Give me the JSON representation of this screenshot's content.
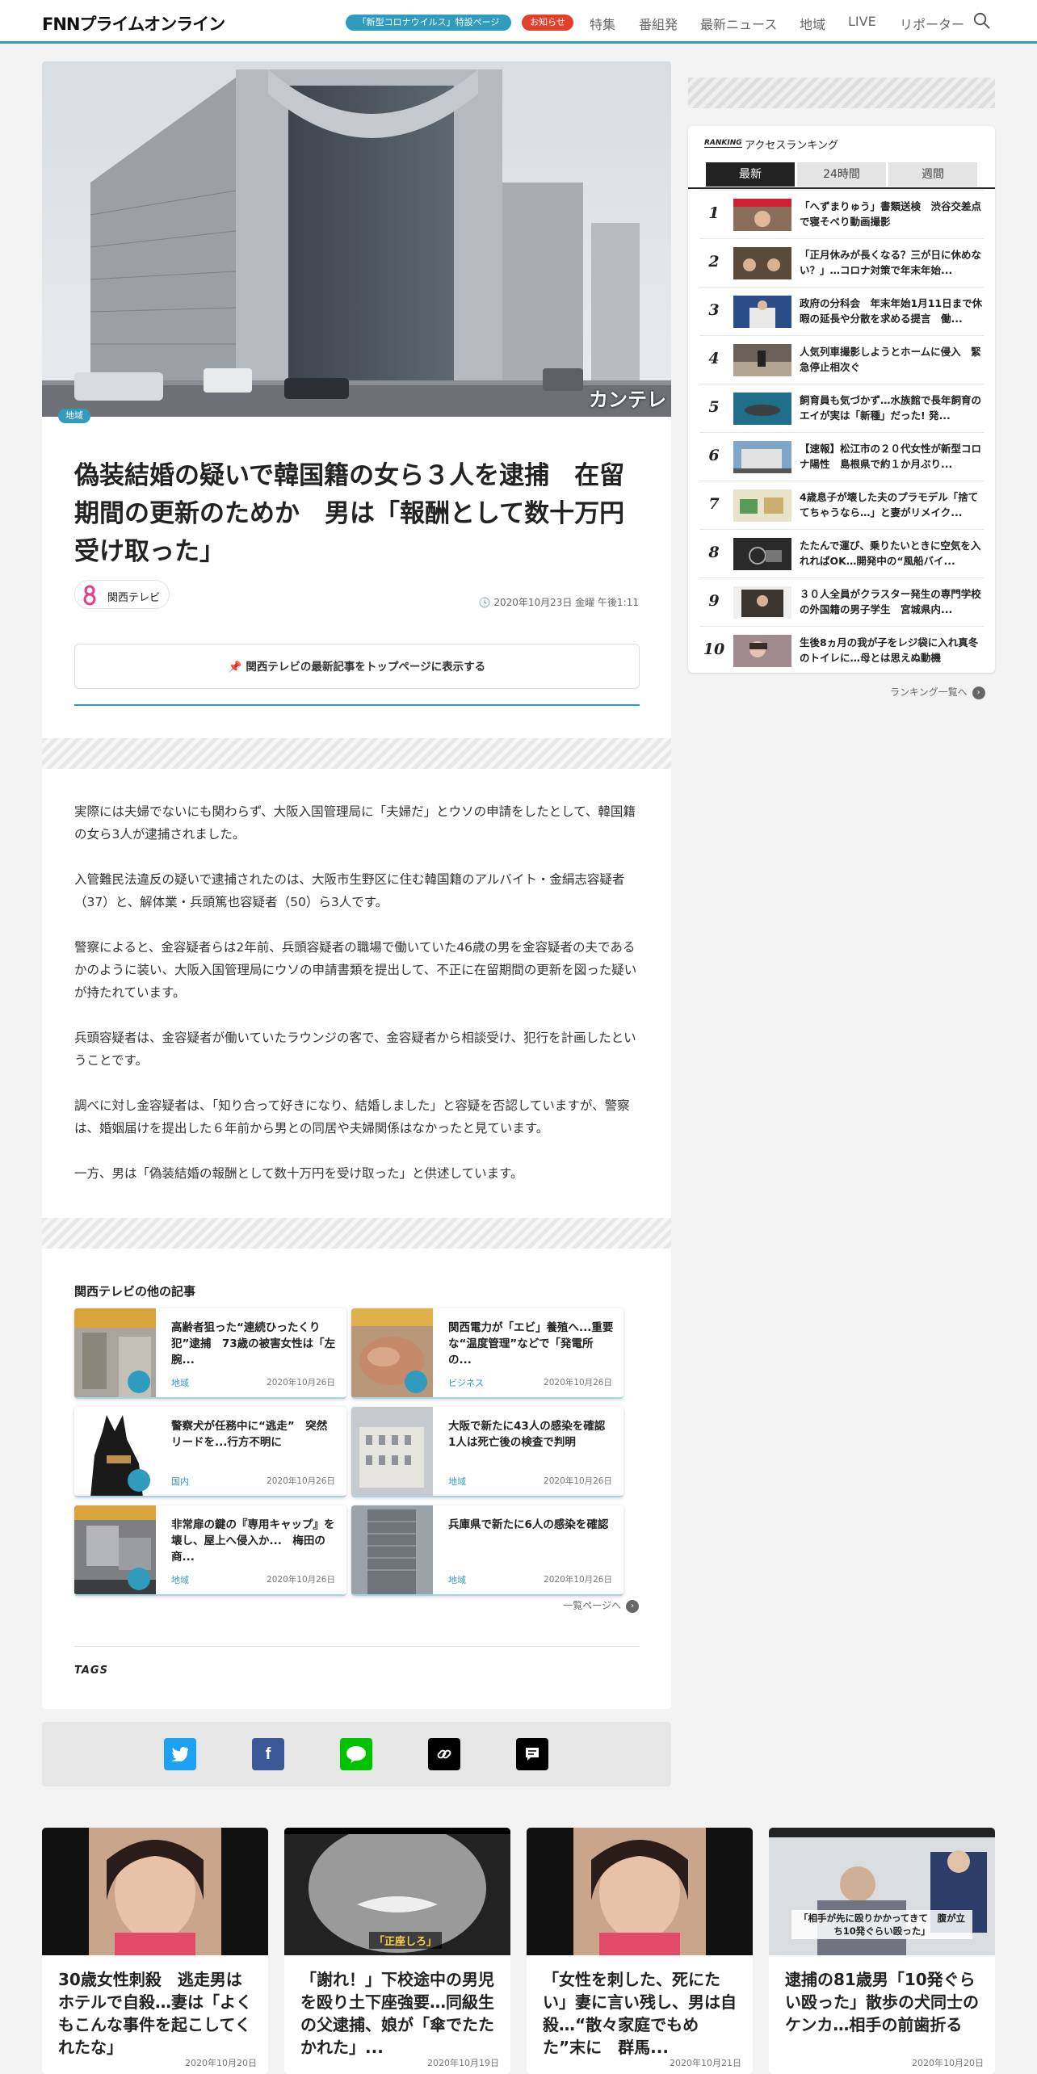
{
  "header": {
    "logo": "FNNプライムオンライン",
    "pill_covid": "「新型コロナウイルス」特設ページ",
    "pill_notice": "お知らせ",
    "nav": [
      "特集",
      "番組発",
      "最新ニュース",
      "地域",
      "LIVE",
      "リポーター"
    ],
    "colors": {
      "accent": "#2f9bbd",
      "notice": "#e2402a"
    }
  },
  "article": {
    "image_watermark": "カンテレ",
    "category": "地域",
    "title": "偽装結婚の疑いで韓国籍の女ら３人を逮捕　在留期間の更新のためか　男は「報酬として数十万円受け取った」",
    "source": "関西テレビ",
    "date": "2020年10月23日 金曜 午後1:11",
    "pin_label": "関西テレビの最新記事をトップページに表示する",
    "paragraphs": [
      "実際には夫婦でないにも関わらず、大阪入国管理局に「夫婦だ」とウソの申請をしたとして、韓国籍の女ら3人が逮捕されました。",
      "入管難民法違反の疑いで逮捕されたのは、大阪市生野区に住む韓国籍のアルバイト・金絹志容疑者（37）と、解体業・兵頭篤也容疑者（50）ら3人です。",
      "警察によると、金容疑者らは2年前、兵頭容疑者の職場で働いていた46歳の男を金容疑者の夫であるかのように装い、大阪入国管理局にウソの申請書類を提出して、不正に在留期間の更新を図った疑いが持たれています。",
      "兵頭容疑者は、金容疑者が働いていたラウンジの客で、金容疑者から相談受け、犯行を計画したということです。",
      "調べに対し金容疑者は、「知り合って好きになり、結婚しました」と容疑を否認していますが、警察は、婚姻届けを提出した６年前から男との同居や夫婦関係はなかったと見ています。",
      "一方、男は「偽装結婚の報酬として数十万円を受け取った」と供述しています。"
    ],
    "related_heading": "関西テレビの他の記事",
    "related": [
      {
        "title": "高齢者狙った“連続ひったくり犯”逮捕　73歳の被害女性は「左腕...",
        "category": "地域",
        "date": "2020年10月26日"
      },
      {
        "title": "関西電力が「エビ」養殖へ...重要な“温度管理”などで「発電所の...",
        "category": "ビジネス",
        "date": "2020年10月26日"
      },
      {
        "title": "警察犬が任務中に“逃走”　突然リードを...行方不明に",
        "category": "国内",
        "date": "2020年10月26日"
      },
      {
        "title": "大阪で新たに43人の感染を確認　1人は死亡後の検査で判明",
        "category": "地域",
        "date": "2020年10月26日"
      },
      {
        "title": "非常扉の鍵の『専用キャップ』を壊し、屋上へ侵入か...　梅田の商...",
        "category": "地域",
        "date": "2020年10月26日"
      },
      {
        "title": "兵庫県で新たに6人の感染を確認",
        "category": "地域",
        "date": "2020年10月26日"
      }
    ],
    "more_link": "一覧ページへ",
    "tags_label": "TAGS"
  },
  "share": [
    "twitter-icon",
    "facebook-icon",
    "line-icon",
    "link-icon",
    "comment-icon"
  ],
  "ranking": {
    "badge": "RANKING",
    "title": "アクセスランキング",
    "tabs": [
      "最新",
      "24時間",
      "週間"
    ],
    "items": [
      {
        "rank": "1",
        "title": "「へずまりゅう」書類送検　渋谷交差点で寝そべり動画撮影"
      },
      {
        "rank": "2",
        "title": "「正月休みが長くなる？三が日に休めない？」…コロナ対策で年末年始..."
      },
      {
        "rank": "3",
        "title": "政府の分科会　年末年始1月11日まで休暇の延長や分散を求める提言　働..."
      },
      {
        "rank": "4",
        "title": "人気列車撮影しようとホームに侵入　緊急停止相次ぐ"
      },
      {
        "rank": "5",
        "title": "飼育員も気づかず…水族館で長年飼育のエイが実は「新種」だった! 発..."
      },
      {
        "rank": "6",
        "title": "【速報】松江市の２０代女性が新型コロナ陽性　島根県で約１か月ぶり..."
      },
      {
        "rank": "7",
        "title": "4歳息子が壊した夫のプラモデル「捨ててちゃうなら…」と妻がリメイク..."
      },
      {
        "rank": "8",
        "title": "たたんで運び、乗りたいときに空気を入れればOK…開発中の“風船バイ..."
      },
      {
        "rank": "9",
        "title": "３０人全員がクラスター発生の専門学校の外国籍の男子学生　宮城県内..."
      },
      {
        "rank": "10",
        "title": "生後8ヵ月の我が子をレジ袋に入れ真冬のトイレに…母とは思えぬ動機"
      }
    ],
    "more_link": "ランキング一覧へ"
  },
  "bottom_cards": [
    {
      "title": "30歳女性刺殺　逃走男はホテルで自殺…妻は「よくもこんな事件を起こしてくれたな」",
      "date": "2020年10月20日",
      "caption": ""
    },
    {
      "title": "「謝れ！」下校途中の男児を殴り土下座強要…同級生の父逮捕、娘が「傘でたたかれた」...",
      "date": "2020年10月19日",
      "caption": "「正座しろ」"
    },
    {
      "title": "「女性を刺した、死にたい」妻に言い残し、男は自殺…“散々家庭でもめた”末に　群馬...",
      "date": "2020年10月21日",
      "caption": ""
    },
    {
      "title": "逮捕の81歳男「10発ぐらい殴った」散歩の犬同士のケンカ…相手の前歯折る",
      "date": "2020年10月20日",
      "caption": "「相手が先に殴りかかってきて　腹が立ち10発ぐらい殴った」"
    }
  ]
}
